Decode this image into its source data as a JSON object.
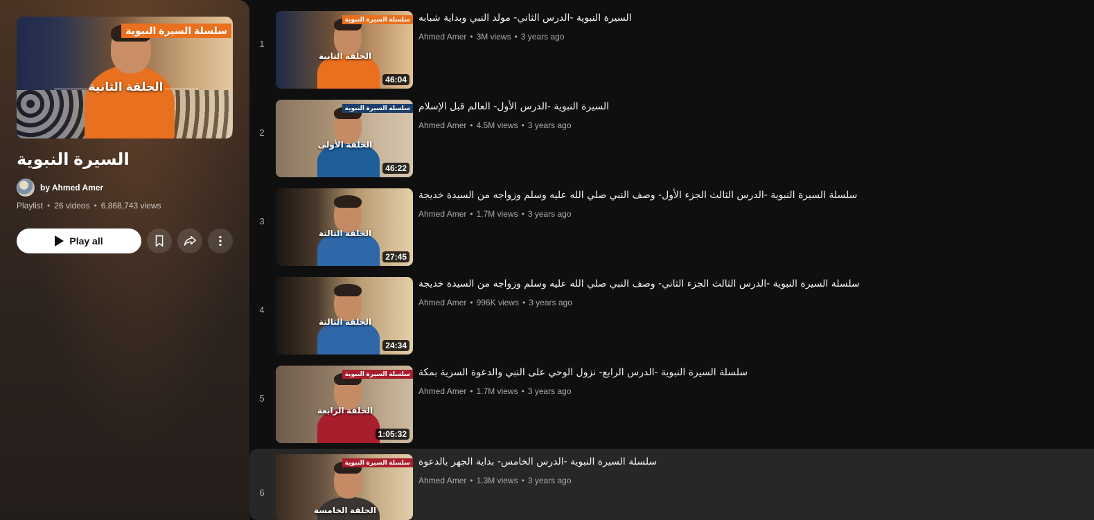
{
  "playlist": {
    "title": "السيرة النبوية",
    "owner": "by Ahmed Amer",
    "type": "Playlist",
    "video_count": "26 videos",
    "views": "6,868,743 views",
    "cover_badge": "سلسلة السيرة النبوية",
    "cover_episode": "الحلقة الثانية",
    "play_all_label": "Play all",
    "icons": {
      "play": "play-icon",
      "save": "bookmark-icon",
      "share": "share-icon",
      "more": "more-vert-icon"
    },
    "accent": "#e8701f"
  },
  "videos": [
    {
      "index": "1",
      "title": "السيرة النبوية -الدرس الثاني- مولد النبي وبداية شبابه",
      "channel": "Ahmed Amer",
      "views": "3M views",
      "age": "3 years ago",
      "duration": "46:04",
      "badge": "سلسلة السيرة النبوية",
      "episode": "الحلقة الثانية"
    },
    {
      "index": "2",
      "title": "السيرة النبوية -الدرس الأول- العالم قبل الإسلام",
      "channel": "Ahmed Amer",
      "views": "4.5M views",
      "age": "3 years ago",
      "duration": "46:22",
      "badge": "سلسلة السيرة النبوية",
      "episode": "الحلقة الأولى"
    },
    {
      "index": "3",
      "title": "سلسلة السيرة النبوية -الدرس الثالث الجزء الأول- وصف النبي صلي الله عليه وسلم وزواجه من السيدة خديجة",
      "channel": "Ahmed Amer",
      "views": "1.7M views",
      "age": "3 years ago",
      "duration": "27:45",
      "badge": "",
      "episode": "الحلقة الثالثة"
    },
    {
      "index": "4",
      "title": "سلسلة السيرة النبوية -الدرس الثالث الجزء الثاني- وصف النبي صلي الله عليه وسلم وزواجه من السيدة خديجة",
      "channel": "Ahmed Amer",
      "views": "996K views",
      "age": "3 years ago",
      "duration": "24:34",
      "badge": "",
      "episode": "الحلقة الثالثة"
    },
    {
      "index": "5",
      "title": "سلسلة السيرة النبوية -الدرس الرابع- نزول الوحي على النبي والدعوة السرية بمكة",
      "channel": "Ahmed Amer",
      "views": "1.7M views",
      "age": "3 years ago",
      "duration": "1:05:32",
      "badge": "سلسلة السيرة النبوية",
      "episode": "الحلقة الرابعة"
    },
    {
      "index": "6",
      "title": "سلسلة السيرة النبوية -الدرس الخامس- بداية الجهر بالدعوة",
      "channel": "Ahmed Amer",
      "views": "1.3M views",
      "age": "3 years ago",
      "duration": "",
      "badge": "سلسلة السيرة النبوية",
      "episode": "الحلقة الخامسة"
    }
  ]
}
